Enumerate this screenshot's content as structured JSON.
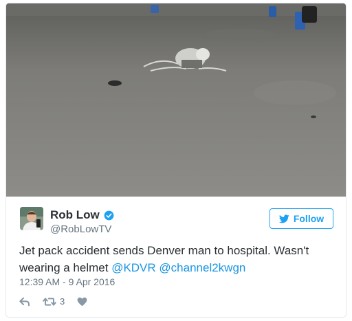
{
  "tweet": {
    "name": "Rob Low",
    "handle": "@RobLowTV",
    "follow_label": "Follow",
    "text_prefix": "Jet pack accident sends Denver man to hospital. Wasn't wearing a helmet ",
    "mention_1": "@KDVR",
    "mention_2": "@channel2kwgn",
    "timestamp": "12:39 AM - 9 Apr 2016",
    "retweet_count": "3"
  },
  "colors": {
    "accent": "#1da1f2",
    "text": "#292f33",
    "muted": "#66757f"
  },
  "icons": [
    "verified-icon",
    "twitter-bird-icon",
    "reply-icon",
    "retweet-icon",
    "like-icon"
  ]
}
